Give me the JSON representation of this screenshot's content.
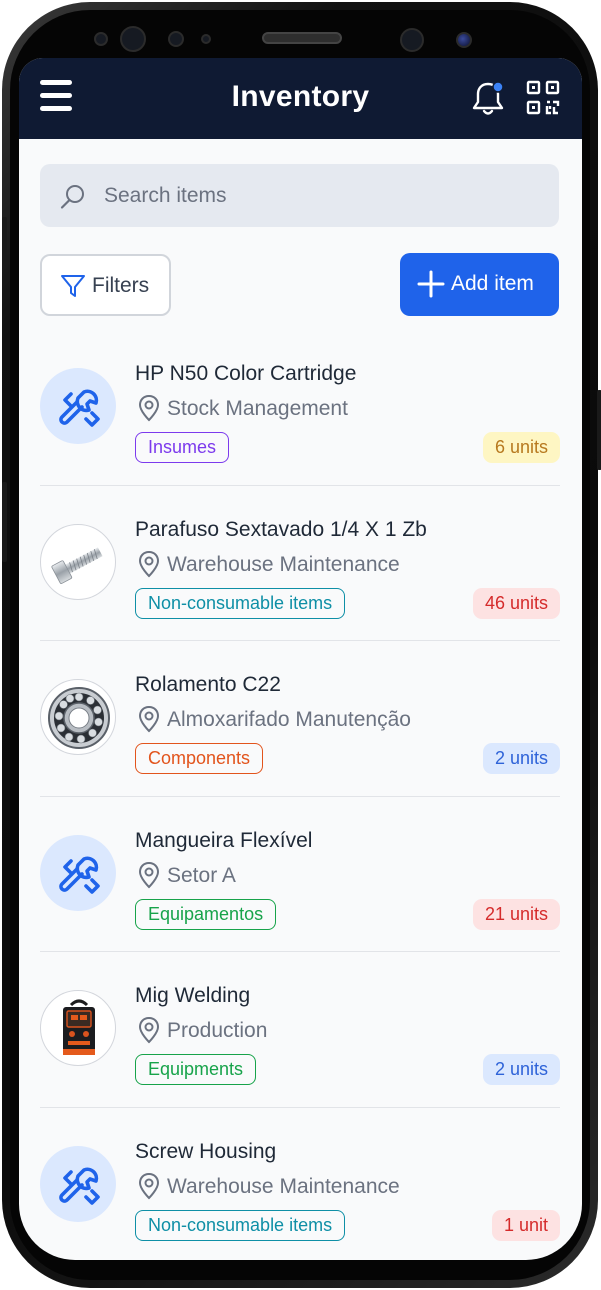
{
  "header": {
    "title": "Inventory"
  },
  "search": {
    "placeholder": "Search items"
  },
  "toolbar": {
    "filters_label": "Filters",
    "add_label": "Add item"
  },
  "colors": {
    "header_bg": "#0f1a33",
    "accent": "#1f63ea",
    "notification_dot": "#3b82f6"
  },
  "items": [
    {
      "name": "HP N50 Color Cartridge",
      "location": "Stock Management",
      "tag": "Insumes",
      "tag_color": "#7c3aed",
      "quantity": "6 units",
      "qty_bg": "#fef6c3",
      "qty_color": "#b7791f",
      "image": "wrench-icon"
    },
    {
      "name": "Parafuso Sextavado 1/4 X 1 Zb",
      "location": "Warehouse Maintenance",
      "tag": "Non-consumable items",
      "tag_color": "#0e8fa6",
      "quantity": "46 units",
      "qty_bg": "#fde2e2",
      "qty_color": "#d52b2b",
      "image": "bolt-photo"
    },
    {
      "name": "Rolamento C22",
      "location": "Almoxarifado Manutenção",
      "tag": "Components",
      "tag_color": "#e2541c",
      "quantity": "2 units",
      "qty_bg": "#dbe8fe",
      "qty_color": "#2e63d8",
      "image": "bearing-photo"
    },
    {
      "name": "Mangueira Flexível",
      "location": "Setor A",
      "tag": "Equipamentos",
      "tag_color": "#17a34a",
      "quantity": "21 units",
      "qty_bg": "#fde2e2",
      "qty_color": "#d52b2b",
      "image": "wrench-icon"
    },
    {
      "name": "Mig Welding",
      "location": "Production",
      "tag": "Equipments",
      "tag_color": "#17a34a",
      "quantity": "2 units",
      "qty_bg": "#dbe8fe",
      "qty_color": "#2e63d8",
      "image": "welder-photo"
    },
    {
      "name": "Screw Housing",
      "location": "Warehouse Maintenance",
      "tag": "Non-consumable items",
      "tag_color": "#0e8fa6",
      "quantity": "1 unit",
      "qty_bg": "#fde2e2",
      "qty_color": "#d52b2b",
      "image": "wrench-icon"
    }
  ]
}
